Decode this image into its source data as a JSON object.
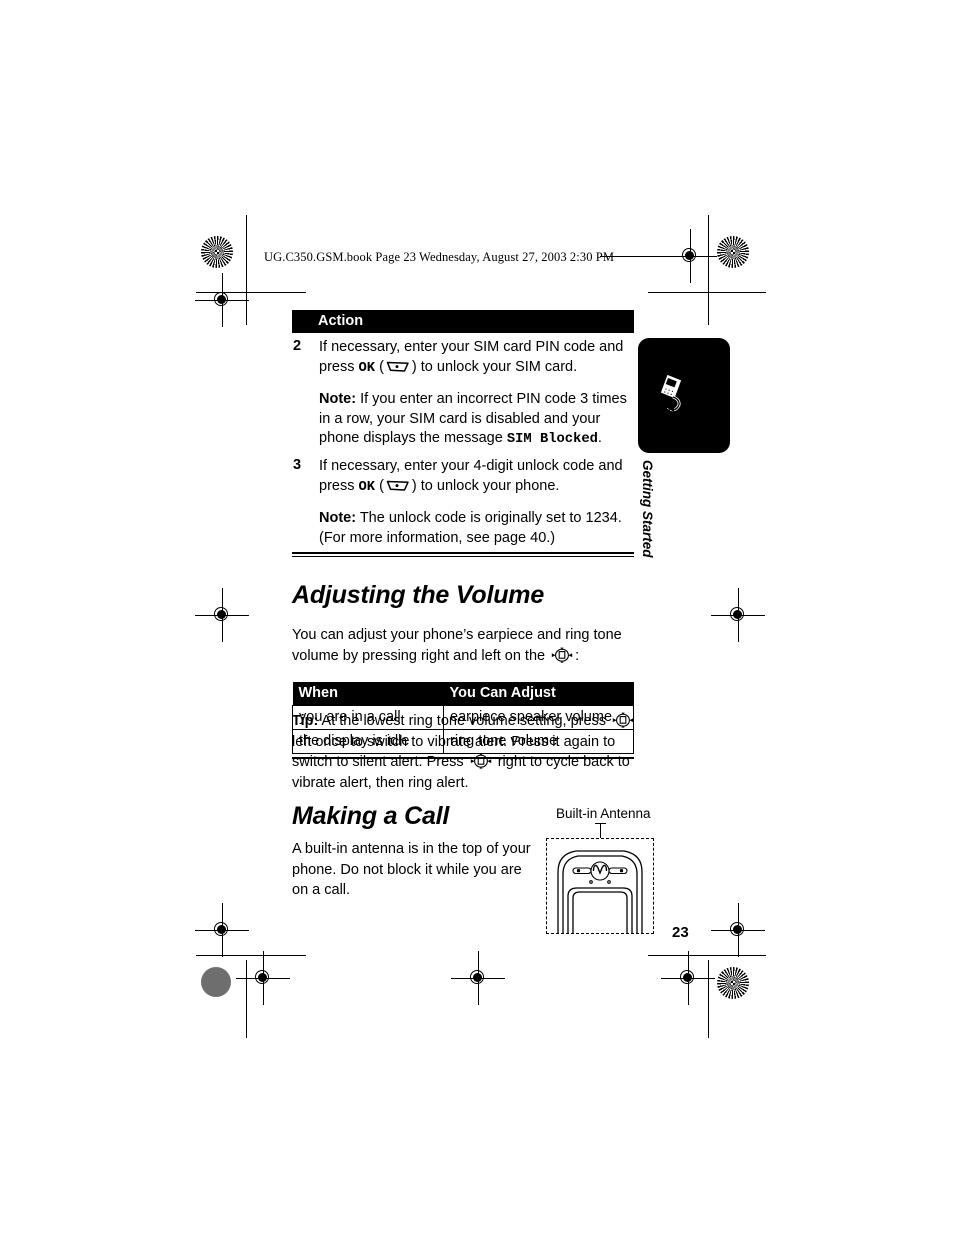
{
  "document": {
    "book_header": "UG.C350.GSM.book  Page 23  Wednesday, August 27, 2003  2:30 PM",
    "page_number": "23",
    "side_tab": {
      "label": "Getting Started",
      "icon": "running-phone-icon"
    }
  },
  "steps_table": {
    "header": "Action",
    "rows": [
      {
        "number": "2",
        "paragraphs": [
          {
            "segments": [
              {
                "text": "If necessary, enter your SIM card PIN code and press ",
                "style": "normal"
              },
              {
                "text": "OK",
                "style": "mono"
              },
              {
                "text": " (",
                "style": "normal"
              },
              {
                "text": "soft-key-icon",
                "style": "icon"
              },
              {
                "text": ") to unlock your SIM card.",
                "style": "normal"
              }
            ]
          },
          {
            "segments": [
              {
                "text": "Note:",
                "style": "bold"
              },
              {
                "text": " If you enter an incorrect PIN code 3 times in a row, your SIM card is disabled and your phone displays the message ",
                "style": "normal"
              },
              {
                "text": "SIM Blocked",
                "style": "mono"
              },
              {
                "text": ".",
                "style": "normal"
              }
            ]
          }
        ]
      },
      {
        "number": "3",
        "paragraphs": [
          {
            "segments": [
              {
                "text": "If necessary, enter your 4-digit unlock code and press ",
                "style": "normal"
              },
              {
                "text": "OK",
                "style": "mono"
              },
              {
                "text": " (",
                "style": "normal"
              },
              {
                "text": "soft-key-icon",
                "style": "icon"
              },
              {
                "text": ") to unlock your phone.",
                "style": "normal"
              }
            ]
          },
          {
            "segments": [
              {
                "text": "Note:",
                "style": "bold"
              },
              {
                "text": " The unlock code is originally set to 1234. (For more information, see page 40.)",
                "style": "normal"
              }
            ]
          }
        ]
      }
    ]
  },
  "volume_section": {
    "heading": "Adjusting the Volume",
    "intro_before_icon": "You can adjust your phone’s earpiece and ring tone volume by pressing right and left on the ",
    "intro_icon": "nav-key-icon",
    "intro_after_icon": ":",
    "table": {
      "columns": [
        "When",
        "You Can Adjust"
      ],
      "rows": [
        [
          "you are in a call",
          "earpiece speaker volume"
        ],
        [
          "the display is idle",
          "ring tone volume"
        ]
      ]
    },
    "tip": {
      "label": "Tip:",
      "part1": " At the lowest ring tone volume setting, press ",
      "icon1": "nav-key-icon",
      "part2": " left once to switch to vibrate alert. Press it again to switch to silent alert. Press ",
      "icon2": "nav-key-icon",
      "part3": " right to cycle back to vibrate alert, then ring alert."
    }
  },
  "call_section": {
    "heading": "Making a Call",
    "body": "A built-in antenna is in the top of your phone. Do not block it while you are on a call.",
    "figure": {
      "label": "Built-in Antenna",
      "icon": "phone-top-antenna-diagram"
    }
  },
  "colors": {
    "ink": "#000000",
    "paper": "#ffffff",
    "halftone_gray": "#6e6e6e"
  }
}
